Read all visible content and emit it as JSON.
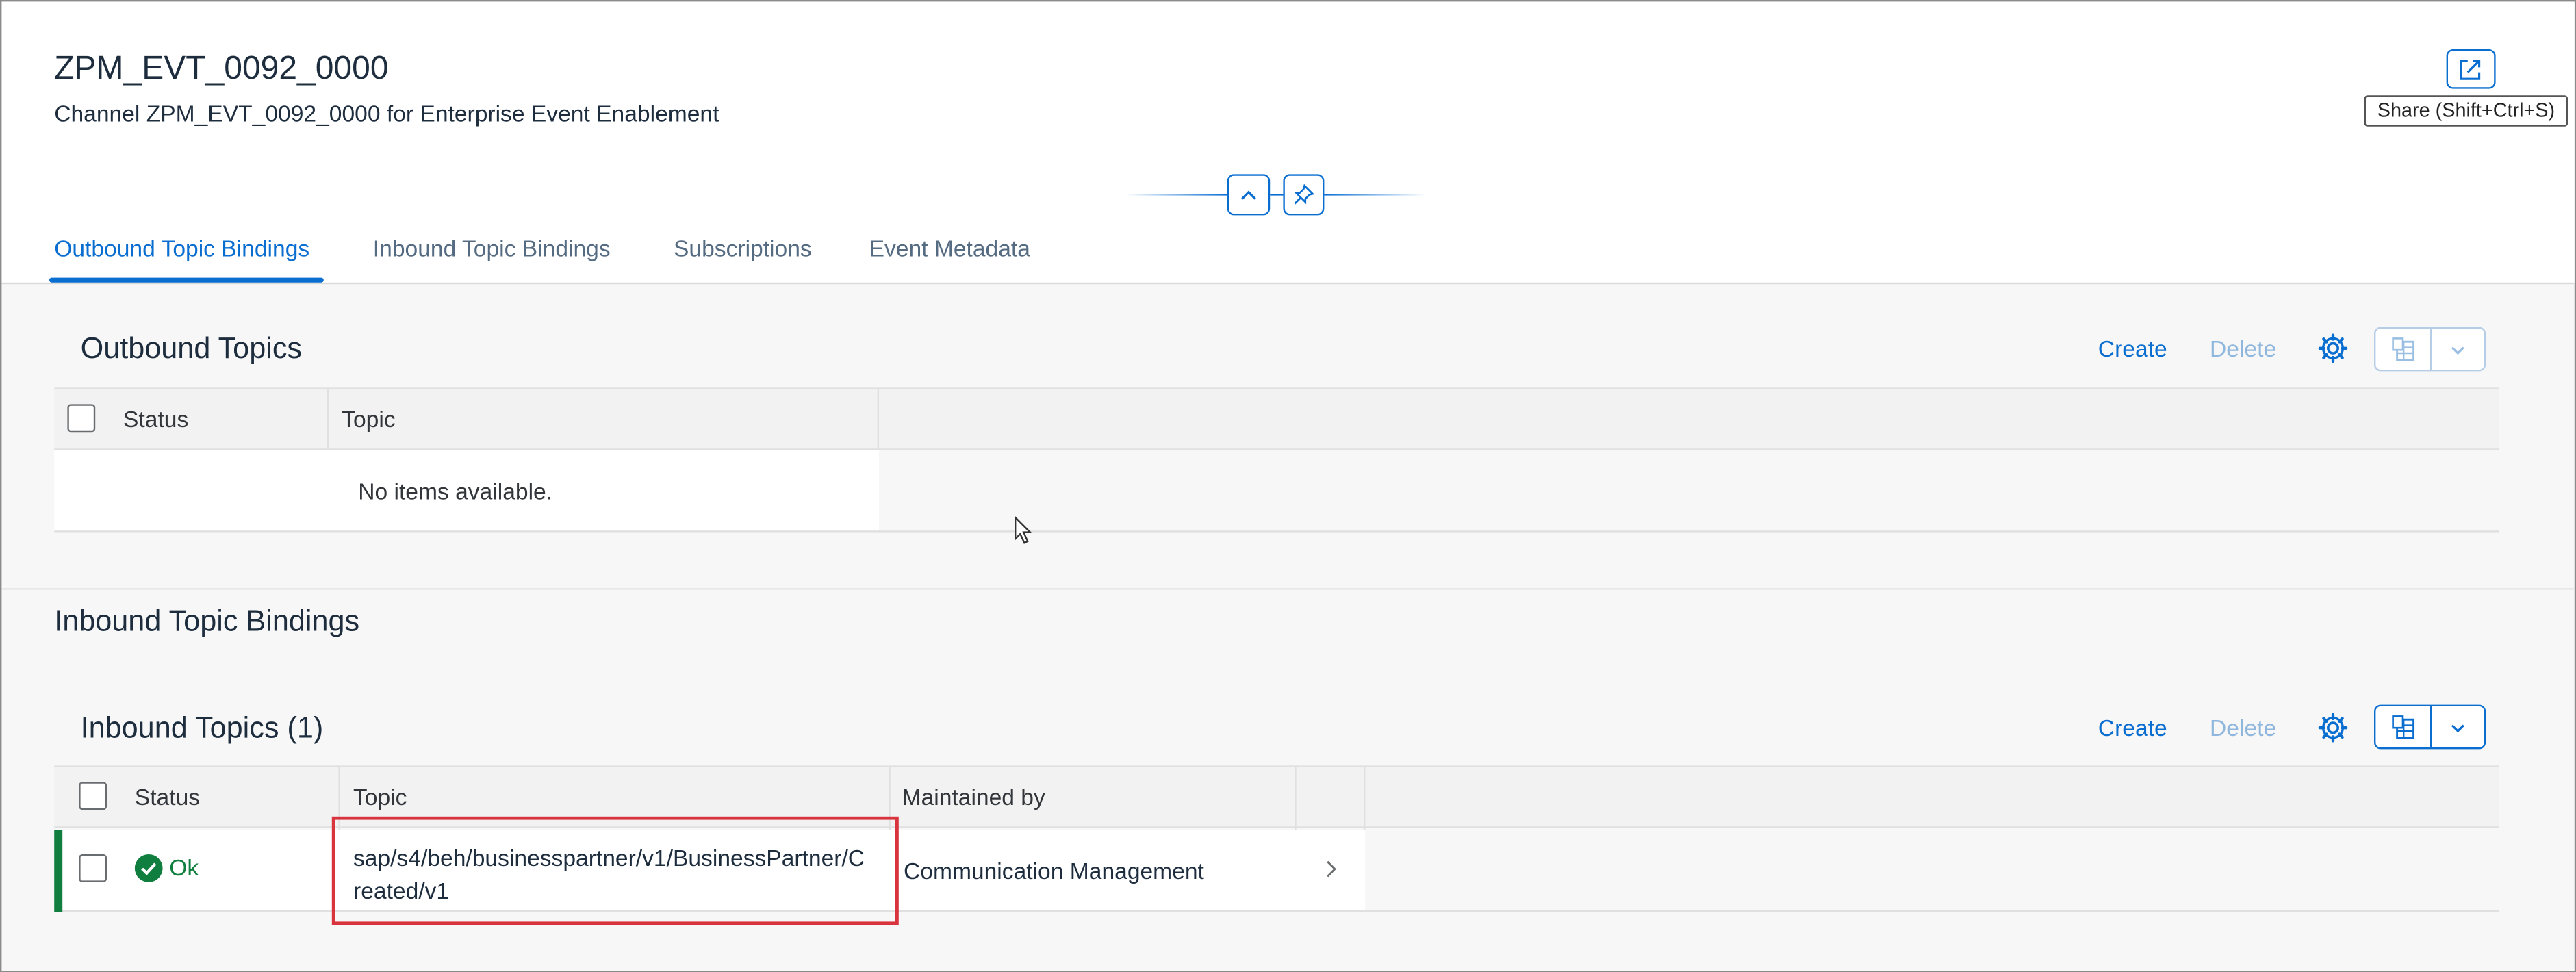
{
  "header": {
    "title": "ZPM_EVT_0092_0000",
    "subtitle": "Channel ZPM_EVT_0092_0000 for Enterprise Event Enablement",
    "share_tooltip": "Share (Shift+Ctrl+S)"
  },
  "tabs": [
    {
      "label": "Outbound Topic Bindings",
      "active": true
    },
    {
      "label": "Inbound Topic Bindings",
      "active": false
    },
    {
      "label": "Subscriptions",
      "active": false
    },
    {
      "label": "Event Metadata",
      "active": false
    }
  ],
  "outbound": {
    "table_title": "Outbound Topics",
    "create_label": "Create",
    "delete_label": "Delete",
    "columns": [
      "Status",
      "Topic"
    ],
    "empty_text": "No items available."
  },
  "inbound": {
    "section_title": "Inbound Topic Bindings",
    "table_title": "Inbound Topics (1)",
    "create_label": "Create",
    "delete_label": "Delete",
    "columns": [
      "Status",
      "Topic",
      "Maintained by"
    ],
    "rows": [
      {
        "status": "Ok",
        "topic_line1": "sap/s4/beh/businesspartner/v1/BusinessPartner/C",
        "topic_line2": "reated/v1",
        "maintained_by": "Communication Management"
      }
    ]
  },
  "icons": {
    "share": "share-icon",
    "collapse": "chevron-up-icon",
    "pin": "pin-icon",
    "settings": "gear-icon",
    "export": "spreadsheet-export-icon",
    "dropdown": "chevron-down-icon",
    "status_ok": "check-circle-icon",
    "navigation": "chevron-right-icon"
  },
  "colors": {
    "accent": "#0a6ed1",
    "success": "#107e3e",
    "highlight": "#d9343e"
  }
}
